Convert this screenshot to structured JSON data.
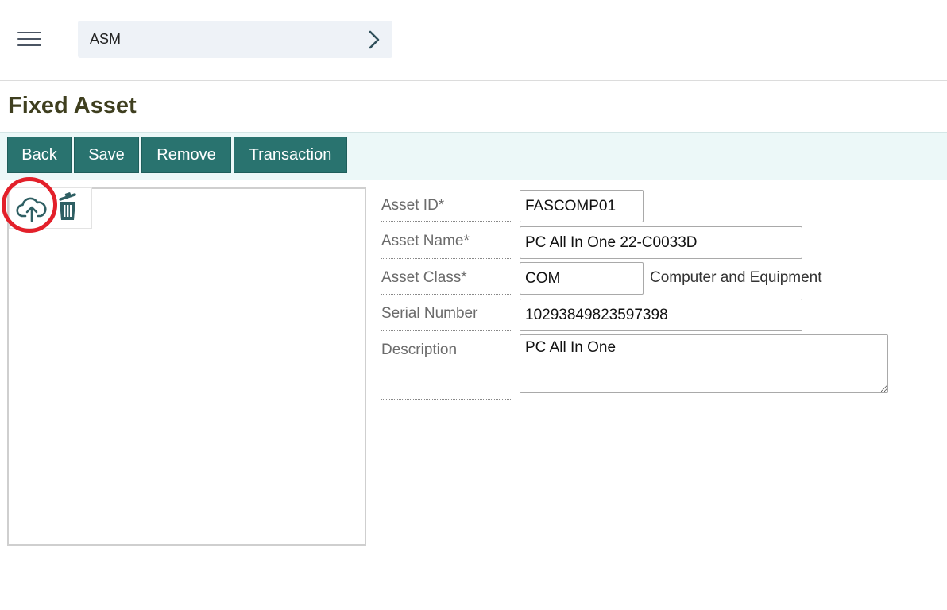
{
  "header": {
    "module": "ASM",
    "menu_icon": "hamburger-menu-icon",
    "chevron_icon": "chevron-right-icon"
  },
  "page": {
    "title": "Fixed Asset"
  },
  "toolbar": {
    "back": "Back",
    "save": "Save",
    "remove": "Remove",
    "transaction": "Transaction",
    "color": "#29736f"
  },
  "image_panel": {
    "upload_icon": "cloud-upload-icon",
    "delete_icon": "trash-icon",
    "highlight_color": "#e3202a"
  },
  "form": {
    "asset_id": {
      "label": "Asset ID*",
      "value": "FASCOMP01"
    },
    "asset_name": {
      "label": "Asset Name*",
      "value": "PC All In One 22-C0033D"
    },
    "asset_class": {
      "label": "Asset Class*",
      "value": "COM",
      "description": "Computer and Equipment"
    },
    "serial_number": {
      "label": "Serial Number",
      "value": "10293849823597398"
    },
    "description": {
      "label": "Description",
      "value": "PC All In One"
    }
  }
}
